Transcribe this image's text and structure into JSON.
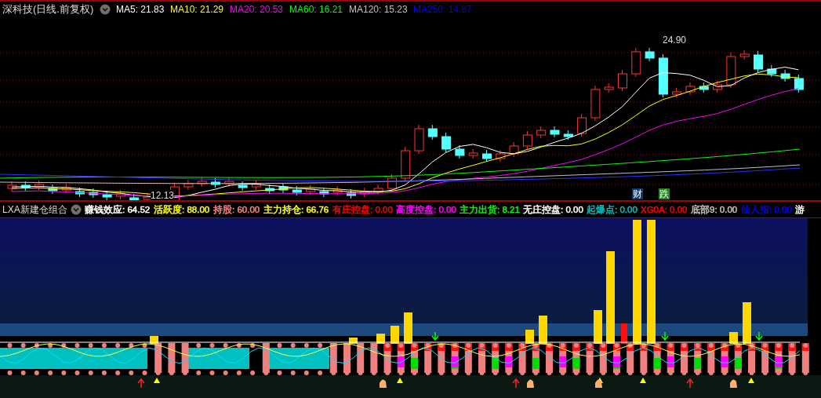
{
  "price_panel": {
    "title": "深科技(日线.前复权)",
    "indicators": [
      {
        "text": "MA5: 21.83",
        "color": "#ffffff"
      },
      {
        "text": "MA10: 21.29",
        "color": "#ffff00"
      },
      {
        "text": "MA20: 20.53",
        "color": "#ff00ff"
      },
      {
        "text": "MA60: 16.21",
        "color": "#00ff00"
      },
      {
        "text": "MA120: 15.23",
        "color": "#c0c0c0"
      },
      {
        "text": "MA250: 14.87",
        "color": "#0000ff"
      }
    ],
    "high_label": "24.90",
    "low_label": "12.13",
    "badges": [
      {
        "text": "财",
        "color": "#0a3a78"
      },
      {
        "text": "跌",
        "color": "#1f8a1f"
      }
    ]
  },
  "indicator_panel": {
    "title": "LXA新建仓组合",
    "indicators": [
      {
        "text": "赚钱效应: 64.52",
        "color": "#ffffff"
      },
      {
        "text": "活跃度: 88.00",
        "color": "#ffff00"
      },
      {
        "text": "持股: 60.00",
        "color": "#ff8080"
      },
      {
        "text": "主力持仓: 66.76",
        "color": "#ffff00"
      },
      {
        "text": "有庄控盘: 0.00",
        "color": "#ff0000"
      },
      {
        "text": "高度控盘: 0.00",
        "color": "#ff00ff"
      },
      {
        "text": "主力出货: 8.21",
        "color": "#00ff00"
      },
      {
        "text": "无庄控盘: 0.00",
        "color": "#ffffff"
      },
      {
        "text": "起爆点: 0.00",
        "color": "#00c0c0"
      },
      {
        "text": "XG0A: 0.00",
        "color": "#ff0000"
      },
      {
        "text": "底部9: 0.00",
        "color": "#c0c0c0"
      },
      {
        "text": "仙人指: 0.00",
        "color": "#0000ff"
      },
      {
        "text": "游",
        "color": "#ffffff"
      }
    ]
  }
}
